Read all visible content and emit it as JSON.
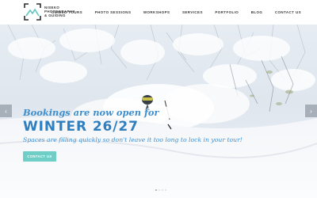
{
  "logo": {
    "lines": [
      "NISEKO",
      "PHOTOGRAPHY",
      "& GUIDING"
    ],
    "icon": "mountain-frame-logo"
  },
  "nav": {
    "items": [
      "GUIDED TOURS",
      "PHOTO SESSIONS",
      "WORKSHOPS",
      "SERVICES",
      "PORTFOLIO",
      "BLOG",
      "CONTACT US"
    ]
  },
  "hero": {
    "headline_1": "Bookings are now open for",
    "headline_2": "WINTER 26/27",
    "subhead": "Spaces are filling quickly so don't leave it too long to lock in your tour!",
    "cta": "CONTACT US",
    "prev_icon": "chevron-left-icon",
    "next_icon": "chevron-right-icon",
    "slides_count": 4,
    "active_slide": 1
  },
  "colors": {
    "accent_blue": "#2e7fc0",
    "cta_teal": "#6fcfc7",
    "nav_text": "#3a3a3a"
  }
}
